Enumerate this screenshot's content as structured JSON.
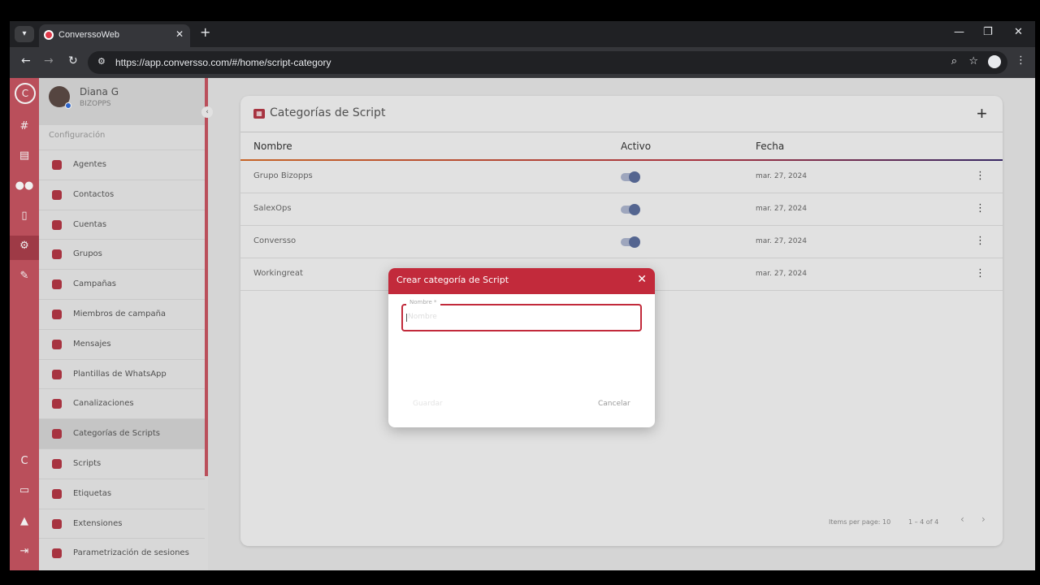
{
  "browser": {
    "tab_title": "ConverssoWeb",
    "url": "https://app.conversso.com/#/home/script-category"
  },
  "user": {
    "name": "Diana G",
    "org": "BIZOPPS"
  },
  "sidebar": {
    "section": "Configuración",
    "items": [
      {
        "label": "Agentes",
        "icon": "person-circle-icon"
      },
      {
        "label": "Contactos",
        "icon": "contacts-book-icon"
      },
      {
        "label": "Cuentas",
        "icon": "share-icon"
      },
      {
        "label": "Grupos",
        "icon": "group-icon"
      },
      {
        "label": "Campañas",
        "icon": "campaign-people-icon"
      },
      {
        "label": "Miembros de campaña",
        "icon": "globe-icon"
      },
      {
        "label": "Mensajes",
        "icon": "bookmark-icon"
      },
      {
        "label": "Plantillas de WhatsApp",
        "icon": "bookmark-icon"
      },
      {
        "label": "Canalizaciones",
        "icon": "bookmark-icon"
      },
      {
        "label": "Categorías de Scripts",
        "icon": "script-icon"
      },
      {
        "label": "Scripts",
        "icon": "script-icon"
      },
      {
        "label": "Etiquetas",
        "icon": "tag-icon"
      },
      {
        "label": "Extensiones",
        "icon": "puzzle-icon"
      },
      {
        "label": "Parametrización de sesiones",
        "icon": "trend-icon"
      }
    ]
  },
  "main": {
    "title": "Categorías de Script",
    "columns": {
      "name": "Nombre",
      "active": "Activo",
      "date": "Fecha"
    },
    "rows": [
      {
        "name": "Grupo Bizopps",
        "active": true,
        "date": "mar. 27, 2024"
      },
      {
        "name": "SalexOps",
        "active": true,
        "date": "mar. 27, 2024"
      },
      {
        "name": "Conversso",
        "active": true,
        "date": "mar. 27, 2024"
      },
      {
        "name": "Workingreat",
        "active": true,
        "date": "mar. 27, 2024"
      }
    ],
    "pagination": {
      "items_per_page": "Items per page: 10",
      "range": "1 – 4 of 4"
    }
  },
  "modal": {
    "title": "Crear categoría de Script",
    "field_label": "Nombre *",
    "field_placeholder": "Nombre",
    "save_label": "Guardar",
    "cancel_label": "Cancelar"
  },
  "colors": {
    "brand": "#c65461",
    "accent": "#c22a3b"
  }
}
